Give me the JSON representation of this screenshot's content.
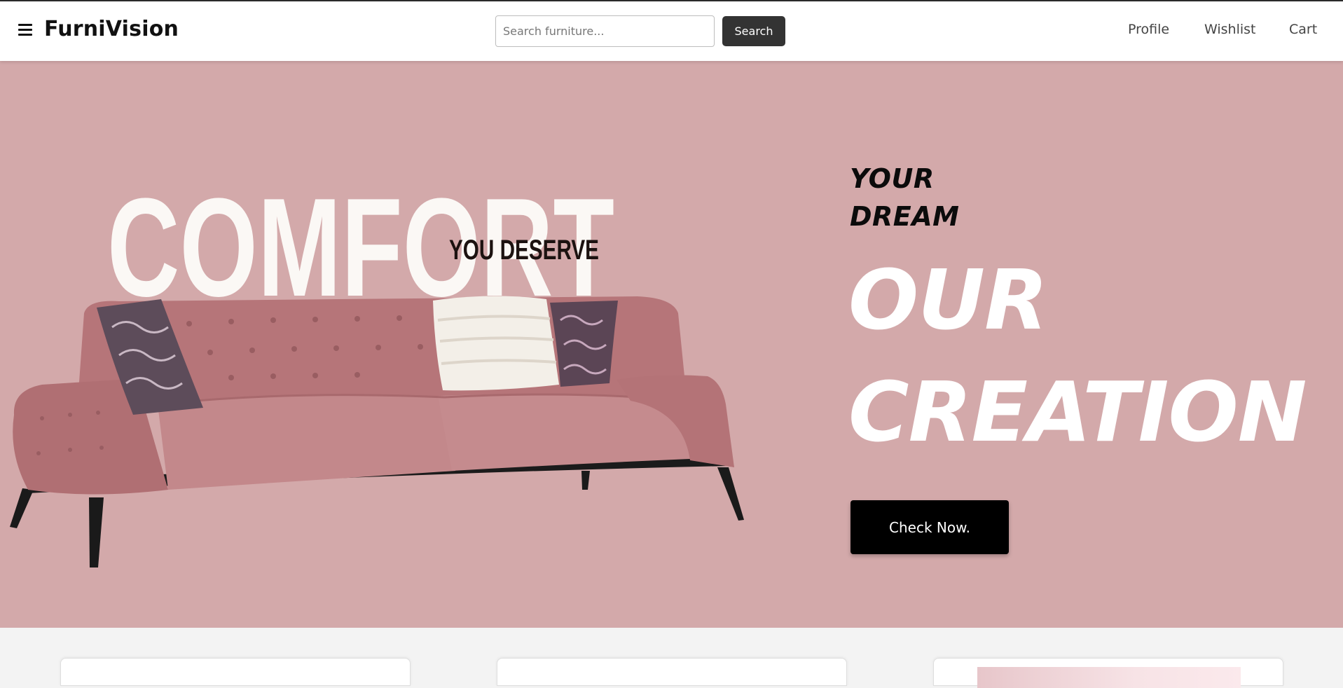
{
  "header": {
    "logo": "FurniVision",
    "search_placeholder": "Search furniture...",
    "search_value": "",
    "search_label": "Search",
    "nav": [
      "Profile",
      "Wishlist",
      "Cart"
    ]
  },
  "hero": {
    "image_text_big": "COMFORT",
    "image_text_small": "YOU DESERVE",
    "tagline_small": [
      "YOUR",
      "DREAM"
    ],
    "tagline_big": [
      "OUR",
      "CREATION"
    ],
    "cta_label": "Check Now."
  },
  "colors": {
    "hero_bg": "#d3a9aa",
    "sofa": "#b97a7e",
    "button_dark": "#000000",
    "search_button": "#333333"
  },
  "icons": [
    "menu-icon"
  ]
}
